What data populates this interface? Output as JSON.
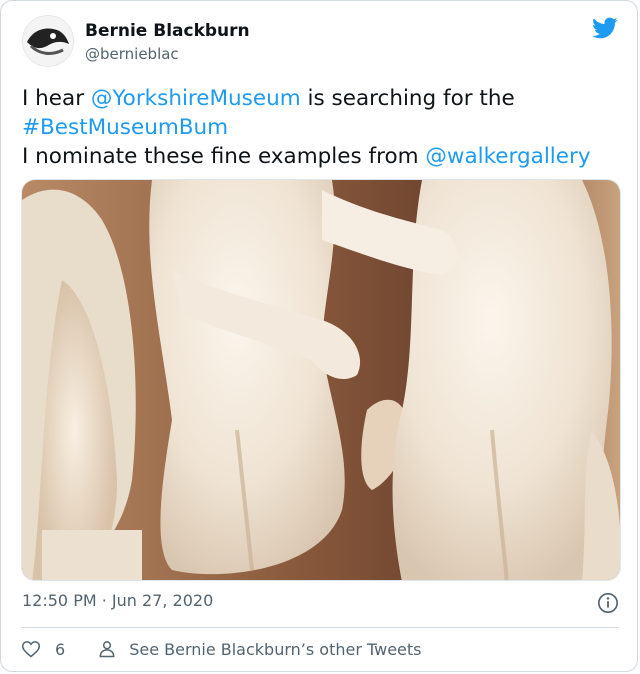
{
  "tweet": {
    "author_name": "Bernie Blackburn",
    "author_handle": "@bernieblac",
    "text_part1": "I hear ",
    "mention1": "@YorkshireMuseum",
    "text_part2": " is searching for the",
    "hashtag": "#BestMuseumBum",
    "text_part3": "I nominate these fine examples from ",
    "mention2": "@walkergallery",
    "timestamp": "12:50 PM · Jun 27, 2020",
    "like_count": "6",
    "see_more_label": "See Bernie Blackburn’s other Tweets"
  },
  "colors": {
    "link": "#1d9bf0",
    "secondary": "#536471",
    "brand": "#1d9bf0"
  },
  "icons": [
    "twitter-bird-icon",
    "info-icon",
    "heart-icon",
    "person-icon"
  ]
}
